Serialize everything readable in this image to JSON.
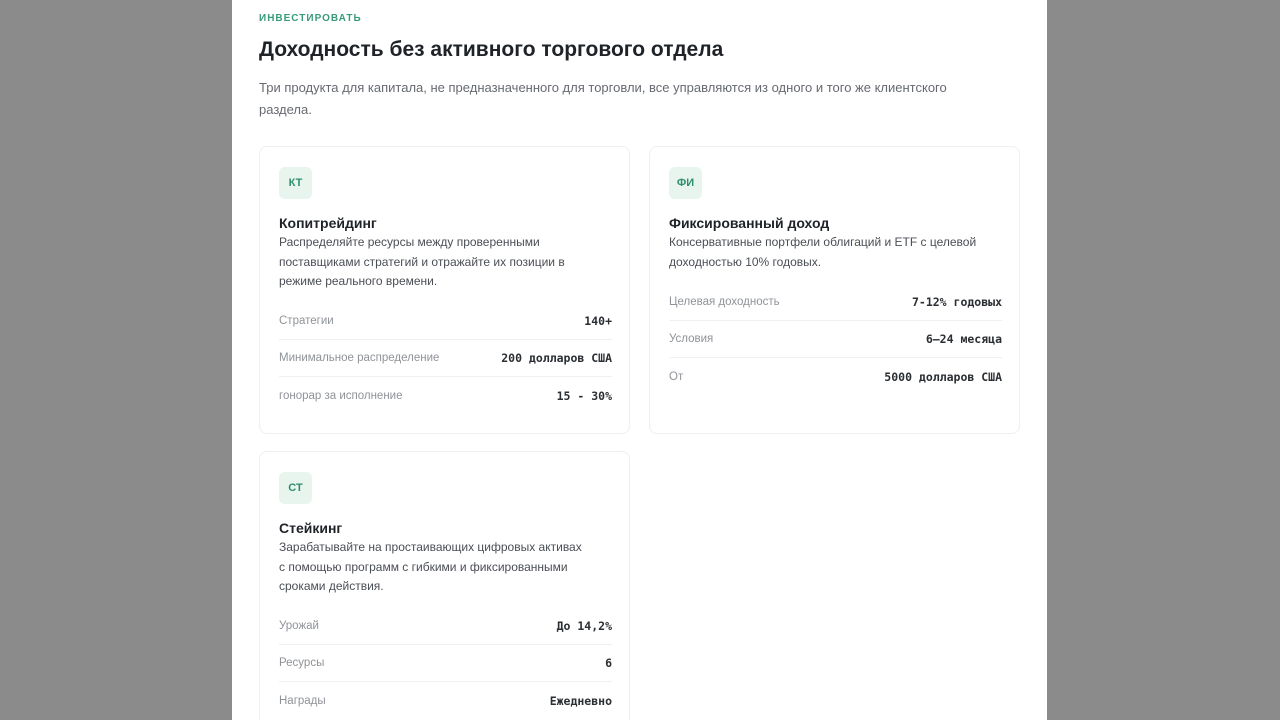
{
  "section": {
    "eyebrow": "ИНВЕСТИРОВАТЬ",
    "title": "Доходность без активного торгового отдела",
    "subtitle": "Три продукта для капитала, не предназначенного для торговли, все управляются из одного и того же клиентского раздела."
  },
  "cards": [
    {
      "badge": "КТ",
      "title": "Копитрейдинг",
      "description": "Распределяйте ресурсы между проверенными поставщиками стратегий и отражайте их позиции в режиме реального времени.",
      "stats": [
        {
          "label": "Стратегии",
          "value": "140+"
        },
        {
          "label": "Минимальное распределение",
          "value": "200 долларов США"
        },
        {
          "label": "гонорар за исполнение",
          "value": "15 - 30%"
        }
      ]
    },
    {
      "badge": "ФИ",
      "title": "Фиксированный доход",
      "description": "Консервативные портфели облигаций и ETF с целевой доходностью 10% годовых.",
      "stats": [
        {
          "label": "Целевая доходность",
          "value": "7-12% годовых"
        },
        {
          "label": "Условия",
          "value": "6–24 месяца"
        },
        {
          "label": "От",
          "value": "5000 долларов США"
        }
      ]
    },
    {
      "badge": "СТ",
      "title": "Стейкинг",
      "description": "Зарабатывайте на простаивающих цифровых активах с помощью программ с гибкими и фиксированными сроками действия.",
      "stats": [
        {
          "label": "Урожай",
          "value": "До 14,2%"
        },
        {
          "label": "Ресурсы",
          "value": "6"
        },
        {
          "label": "Награды",
          "value": "Ежедневно"
        }
      ]
    }
  ]
}
